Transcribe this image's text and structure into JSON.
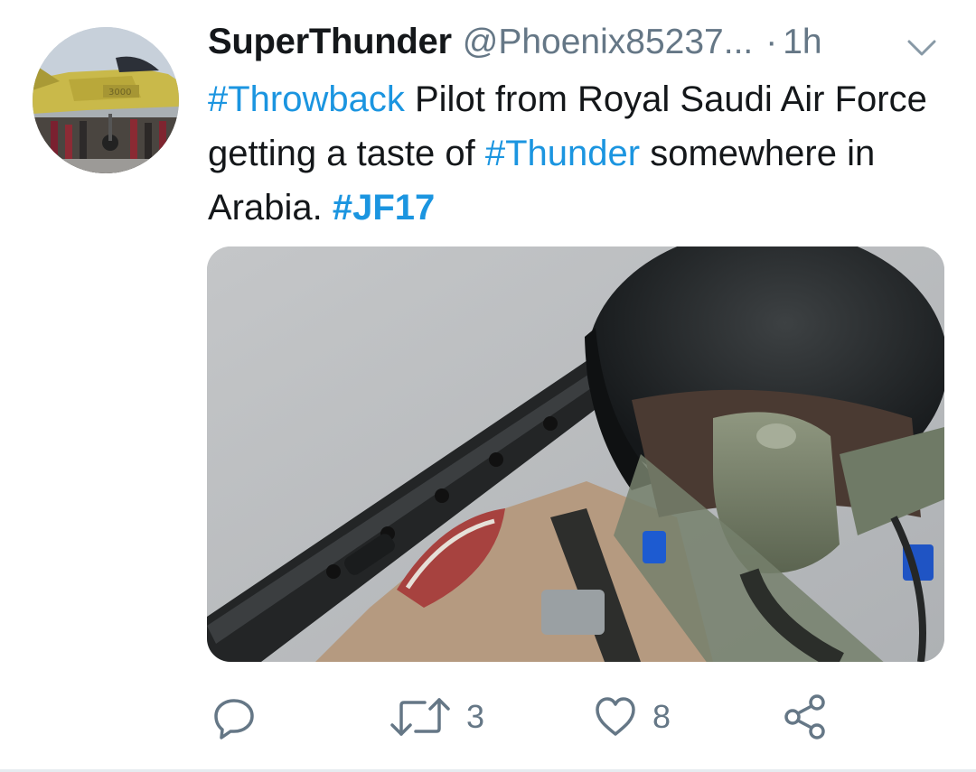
{
  "tweet": {
    "display_name": "SuperThunder",
    "handle": "@Phoenix85237...",
    "separator": "·",
    "time": "1h",
    "text": {
      "hashtag_1": "#Throwback",
      "part_1": " Pilot from Royal Saudi Air Force getting a taste of ",
      "hashtag_2": "#Thunder",
      "part_2": " somewhere in Arabia. ",
      "hashtag_3": "#JF17"
    },
    "avatar_tail_number": "3000"
  },
  "actions": {
    "reply": {
      "icon": "reply-icon",
      "count": ""
    },
    "retweet": {
      "icon": "retweet-icon",
      "count": "3"
    },
    "like": {
      "icon": "heart-icon",
      "count": "8"
    },
    "share": {
      "icon": "share-icon",
      "count": ""
    }
  },
  "colors": {
    "link": "#1b95e0",
    "secondary_text": "#657786",
    "primary_text": "#14171a"
  }
}
